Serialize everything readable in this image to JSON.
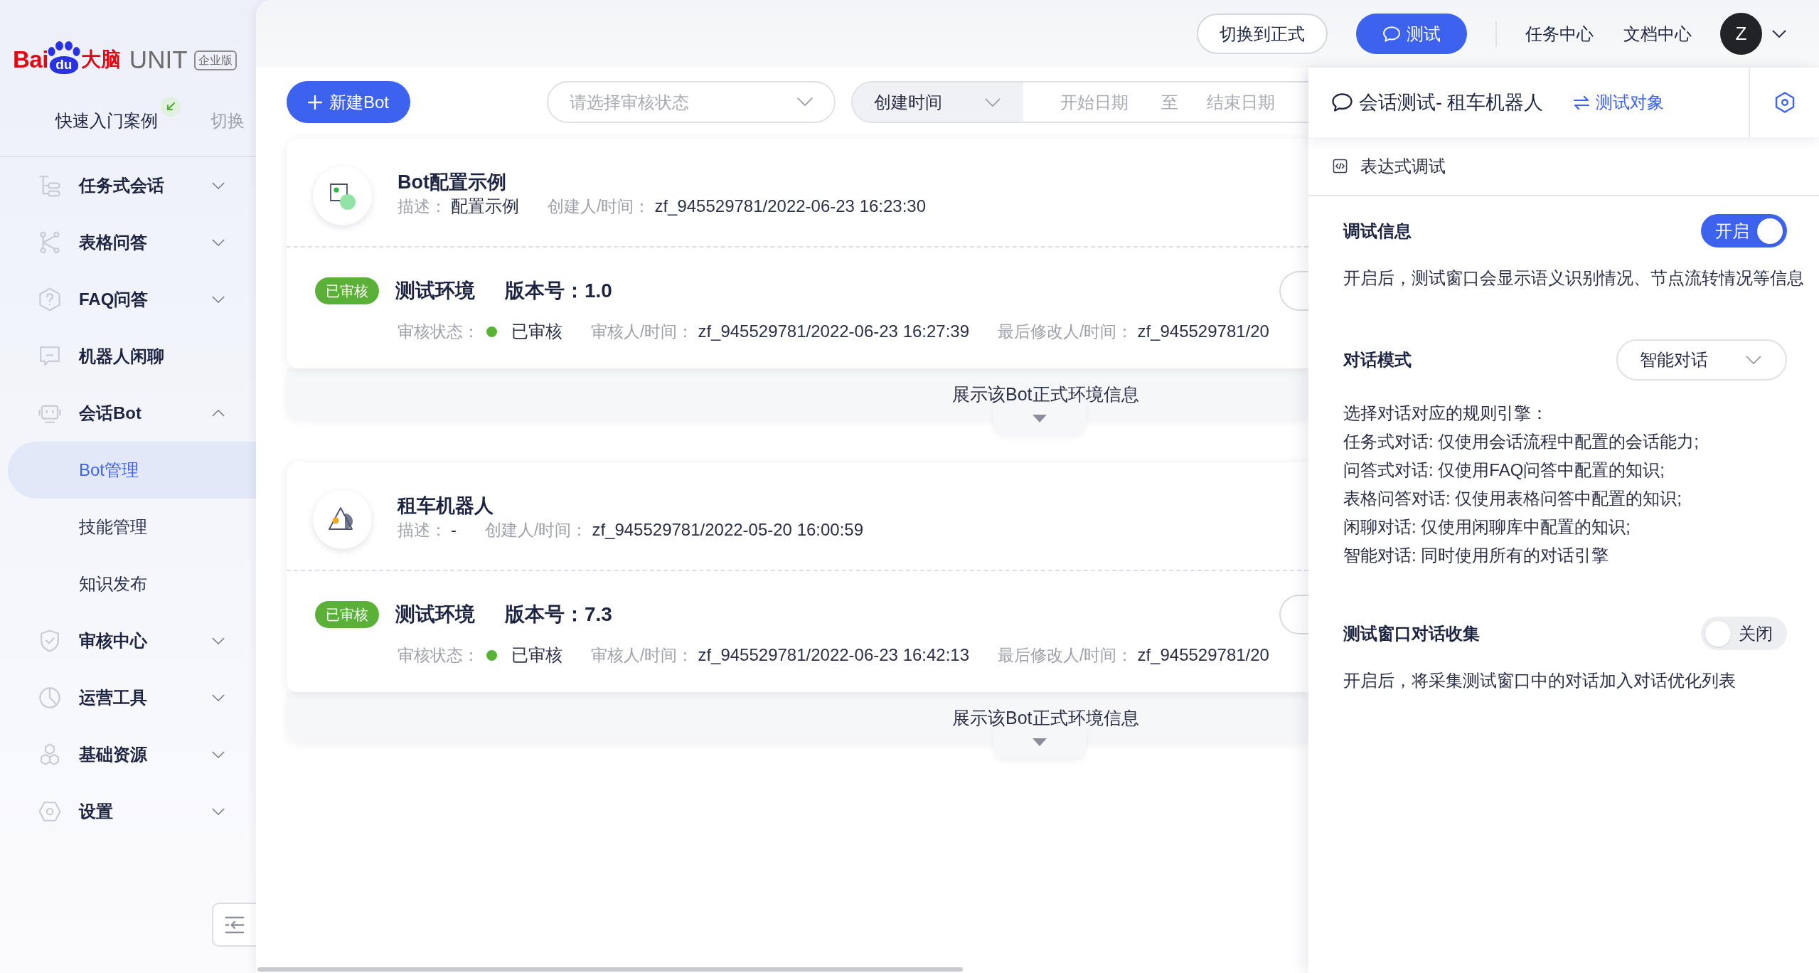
{
  "logo": {
    "brand": "Bai",
    "mark": "du",
    "brand_cn": "大脑",
    "product": "UNIT",
    "edition": "企业版"
  },
  "sidebar": {
    "quick_start": {
      "label": "快速入门案例",
      "action": "切换"
    },
    "items": [
      {
        "label": "任务式会话",
        "kind": "group",
        "expanded": false,
        "selected": false
      },
      {
        "label": "表格问答",
        "kind": "group",
        "expanded": false,
        "selected": false
      },
      {
        "label": "FAQ问答",
        "kind": "group",
        "expanded": false,
        "selected": false
      },
      {
        "label": "机器人闲聊",
        "kind": "link",
        "selected": false
      },
      {
        "label": "会话Bot",
        "kind": "group",
        "expanded": true,
        "selected": false,
        "children": [
          {
            "label": "Bot管理",
            "selected": true
          },
          {
            "label": "技能管理",
            "selected": false
          },
          {
            "label": "知识发布",
            "selected": false
          }
        ]
      },
      {
        "label": "审核中心",
        "kind": "group",
        "expanded": false,
        "selected": false
      },
      {
        "label": "运营工具",
        "kind": "group",
        "expanded": false,
        "selected": false
      },
      {
        "label": "基础资源",
        "kind": "group",
        "expanded": false,
        "selected": false
      },
      {
        "label": "设置",
        "kind": "group",
        "expanded": false,
        "selected": false
      }
    ]
  },
  "topbar": {
    "buttons": [
      {
        "label": "切换到正式",
        "kind": "outline"
      },
      {
        "label": "测试",
        "kind": "primary"
      }
    ],
    "links": [
      "任务中心",
      "文档中心"
    ],
    "avatar": "Z"
  },
  "toolbar": {
    "new_button": "新建Bot",
    "status_select": {
      "placeholder": "请选择审核状态"
    },
    "date_filter": {
      "field": "创建时间",
      "start_placeholder": "开始日期",
      "separator": "至",
      "end_placeholder": "结束日期"
    }
  },
  "bots": [
    {
      "name": "Bot配置示例",
      "info": [
        {
          "label": "描述：",
          "value": "配置示例"
        },
        {
          "label": "创建人/时间：",
          "value": "zf_945529781/2022-06-23 16:23:30"
        }
      ],
      "environment": {
        "badge": "已审核",
        "name": "测试环境",
        "version_label": "版本号：",
        "version": "1.0",
        "details": [
          {
            "kind": "status",
            "label": "审核状态：",
            "value": "已审核"
          },
          {
            "kind": "text",
            "label": "审核人/时间：",
            "value": "zf_945529781/2022-06-23 16:27:39"
          },
          {
            "kind": "text",
            "label": "最后修改人/时间：",
            "value": "zf_945529781/20"
          }
        ]
      },
      "expand_label": "展示该Bot正式环境信息"
    },
    {
      "name": "租车机器人",
      "info": [
        {
          "label": "描述：",
          "value": "-"
        },
        {
          "label": "创建人/时间：",
          "value": "zf_945529781/2022-05-20 16:00:59"
        }
      ],
      "environment": {
        "badge": "已审核",
        "name": "测试环境",
        "version_label": "版本号：",
        "version": "7.3",
        "details": [
          {
            "kind": "status",
            "label": "审核状态：",
            "value": "已审核"
          },
          {
            "kind": "text",
            "label": "审核人/时间：",
            "value": "zf_945529781/2022-06-23 16:42:13"
          },
          {
            "kind": "text",
            "label": "最后修改人/时间：",
            "value": "zf_945529781/20"
          }
        ]
      },
      "expand_label": "展示该Bot正式环境信息"
    }
  ],
  "test_panel": {
    "title": "会话测试- 租车机器人",
    "target_link": "测试对象",
    "tab": "表达式调试",
    "sections": [
      {
        "kind": "toggle",
        "title": "调试信息",
        "toggle": {
          "on": true,
          "label": "开启"
        },
        "lines": [
          "开启后，测试窗口会显示语义识别情况、节点流转情况等信息"
        ]
      },
      {
        "kind": "select",
        "title": "对话模式",
        "select": {
          "value": "智能对话"
        },
        "lines": [
          "选择对话对应的规则引擎：",
          "任务式对话: 仅使用会话流程中配置的会话能力;",
          "问答式对话: 仅使用FAQ问答中配置的知识;",
          "表格问答对话: 仅使用表格问答中配置的知识;",
          "闲聊对话: 仅使用闲聊库中配置的知识;",
          "智能对话: 同时使用所有的对话引擎"
        ]
      },
      {
        "kind": "toggle",
        "title": "测试窗口对话收集",
        "toggle": {
          "on": false,
          "label": "关闭"
        },
        "lines": [
          "开启后，将采集测试窗口中的对话加入对话优化列表"
        ]
      }
    ]
  }
}
